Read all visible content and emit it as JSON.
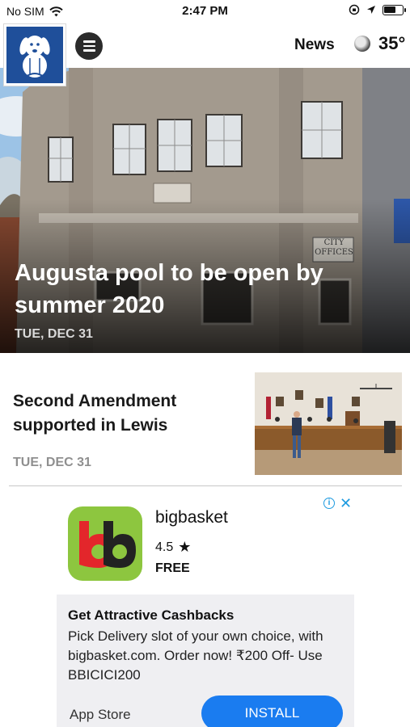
{
  "status_bar": {
    "carrier": "No SIM",
    "time": "2:47 PM",
    "battery_level": 0.7
  },
  "header": {
    "section": "News",
    "temperature": "35°",
    "icons": [
      "menu-icon",
      "moon-icon"
    ]
  },
  "hero": {
    "headline": "Augusta pool to be open by summer 2020",
    "date": "TUE, DEC 31",
    "image_signage": [
      "CITY",
      "OFFICES"
    ]
  },
  "articles": [
    {
      "headline": "Second Amendment supported in Lewis",
      "date": "TUE, DEC 31"
    }
  ],
  "ad": {
    "app_name": "bigbasket",
    "rating": "4.5",
    "price": "FREE",
    "headline": "Get Attractive Cashbacks",
    "body": "Pick Delivery slot of your own choice, with bigbasket.com. Order now! ₹200 Off- Use BBICICI200",
    "store": "App Store",
    "install_label": "INSTALL",
    "info_symbol": "i",
    "colors": {
      "icon_bg": "#8dc63f",
      "install_bg": "#1a7cf0",
      "adchoices": "#1e9be0"
    }
  }
}
